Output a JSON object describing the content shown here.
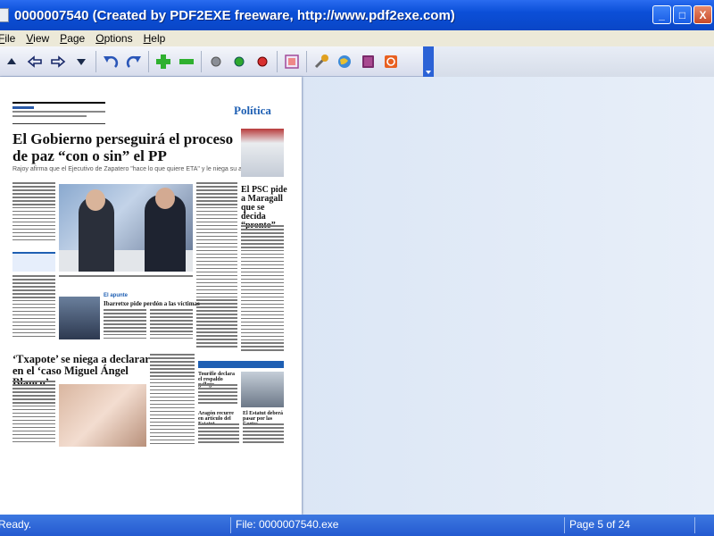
{
  "window": {
    "title": "0000007540 (Created by PDF2EXE freeware, http://www.pdf2exe.com)"
  },
  "window_buttons": {
    "minimize": "_",
    "maximize": "□",
    "close": "X"
  },
  "menu": [
    {
      "label": "File",
      "accel": "F",
      "rest": "ile"
    },
    {
      "label": "View",
      "accel": "V",
      "rest": "iew"
    },
    {
      "label": "Page",
      "accel": "P",
      "rest": "age"
    },
    {
      "label": "Options",
      "accel": "O",
      "rest": "ptions"
    },
    {
      "label": "Help",
      "accel": "H",
      "rest": "elp"
    }
  ],
  "toolbar": {
    "icons": [
      "triangle-up-icon",
      "arrow-left-icon",
      "arrow-right-icon",
      "triangle-down-icon",
      "undo-icon",
      "redo-icon",
      "zoom-in-icon",
      "zoom-out-icon",
      "gray-dot-icon",
      "green-dot-icon",
      "red-dot-icon",
      "fit-page-icon",
      "wrench-icon",
      "globe-icon",
      "book-icon",
      "power-icon"
    ]
  },
  "newspaper": {
    "section": "Política",
    "headline_main": "El Gobierno perseguirá el proceso de paz “con o sin” el PP",
    "subhead_main": "Rajoy afirma que el Ejecutivo de Zapatero \"hace lo que quiere ETA\" y le niega su apoyo",
    "side_headline": "El PSC pide a Maragall que se decida “pronto”",
    "box_label": "El apunte",
    "box_headline": "Ibarretxe pide perdón a las víctimas",
    "headline_second": "‘Txapote’ se niega a declarar en el ‘caso Miguel Ángel Blanco’",
    "euskadi_headline": "Tourifie declara el respaldo gallego",
    "small_headline_1": "Aragón recurre en artículo del Estatut",
    "small_headline_2": "El Estatut deberá pasar por las Cortes"
  },
  "status": {
    "ready": "Ready.",
    "file": "File: 0000007540.exe",
    "page": "Page 5 of 24"
  },
  "colors": {
    "title_bar": "#0b4fd8",
    "status_bar": "#2f64d6",
    "section_blue": "#1e5fb3"
  }
}
